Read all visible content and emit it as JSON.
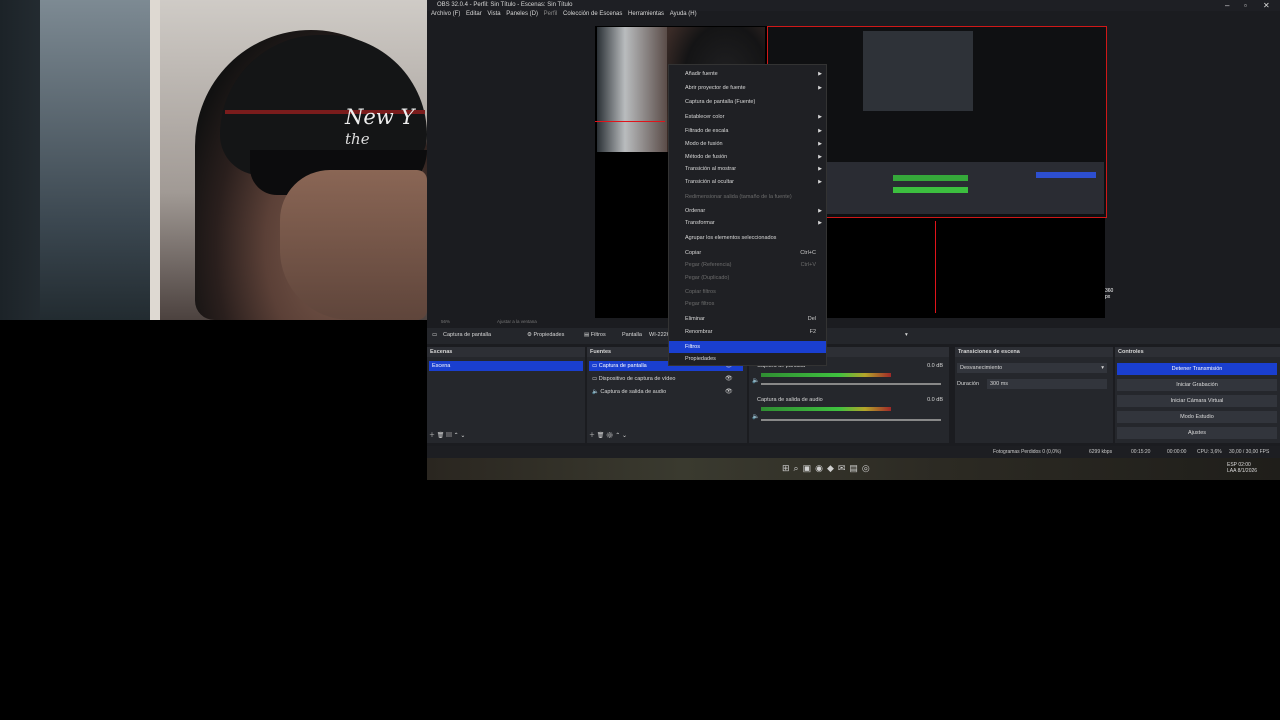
{
  "title": "OBS 32.0.4 - Perfil: Sin Título - Escenas: Sin Título",
  "window_controls": [
    "–",
    "▫",
    "✕"
  ],
  "menu": [
    "Archivo (F)",
    "Editar",
    "Vista",
    "Paneles (D)",
    "Perfil",
    "Colección de Escenas",
    "Herramientas",
    "Ayuda (H)"
  ],
  "webcam_text": {
    "line1": "New Y",
    "line2": "the empire"
  },
  "preview_size_label": "360 px",
  "context_menu": [
    {
      "label": "Añadir fuente",
      "arrow": true
    },
    {
      "label": "Abrir proyector de fuente",
      "arrow": true
    },
    {
      "label": "Captura de pantalla (Fuente)"
    },
    {
      "label": "Establecer color",
      "arrow": true
    },
    {
      "label": "Filtrado de escala",
      "arrow": true
    },
    {
      "label": "Modo de fusión",
      "arrow": true
    },
    {
      "label": "Método de fusión",
      "arrow": true
    },
    {
      "label": "Transición al mostrar",
      "arrow": true
    },
    {
      "label": "Transición al ocultar",
      "arrow": true
    },
    {
      "label": "Redimensionar salida (tamaño de la fuente)",
      "disabled": true
    },
    {
      "label": "Ordenar",
      "arrow": true
    },
    {
      "label": "Transformar",
      "arrow": true
    },
    {
      "label": "Agrupar los elementos seleccionados"
    },
    {
      "label": "Copiar",
      "shortcut": "Ctrl+C"
    },
    {
      "label": "Pegar (Referencia)",
      "shortcut": "Ctrl+V",
      "disabled": true
    },
    {
      "label": "Pegar (Duplicado)",
      "disabled": true
    },
    {
      "label": "Copiar filtros",
      "disabled": true
    },
    {
      "label": "Pegar filtros",
      "disabled": true
    },
    {
      "label": "Eliminar",
      "shortcut": "Del"
    },
    {
      "label": "Renombrar",
      "shortcut": "F2"
    },
    {
      "label": "Filtros",
      "selected": true
    },
    {
      "label": "Propiedades"
    }
  ],
  "status_row": {
    "zoom": "56%",
    "fit": "Ajustar a la ventana"
  },
  "source_toolbar": {
    "source": "Captura de pantalla",
    "props": "Propiedades",
    "filters": "Filtros",
    "screen_label": "Pantalla",
    "screen_value": "WI-2226"
  },
  "scenes": {
    "title": "Escenas",
    "items": [
      "Escena"
    ]
  },
  "sources": {
    "title": "Fuentes",
    "items": [
      "Captura de pantalla",
      "Dispositivo de captura de vídeo",
      "Captura de salida de audio"
    ]
  },
  "mixer": {
    "tracks": [
      {
        "name": "Captura de pantalla",
        "db": "0.0 dB"
      },
      {
        "name": "Captura de salida de audio",
        "db": "0.0 dB"
      }
    ],
    "meter_levels": [
      0.72,
      0.72
    ]
  },
  "transitions": {
    "title": "Transiciones de escena",
    "selected": "Desvanecimiento",
    "duration_label": "Duración",
    "duration_value": "300 ms"
  },
  "controls": {
    "title": "Controles",
    "buttons": [
      "Detener Transmisión",
      "Iniciar Grabación",
      "Iniciar Cámara Virtual",
      "Modo Estudio",
      "Ajustes"
    ]
  },
  "statusbar": {
    "frames": "Fotogramas Perdidos 0 (0,0%)",
    "kbps": "6299 kbps",
    "time": "00:15:20",
    "rec": "00:00:00",
    "cpu": "CPU: 3,6%",
    "fps": "30,00 / 30,00 FPS"
  },
  "taskbar": {
    "lang1": "ESP",
    "lang2": "LAA",
    "time": "02:00",
    "date": "8/1/2026"
  }
}
